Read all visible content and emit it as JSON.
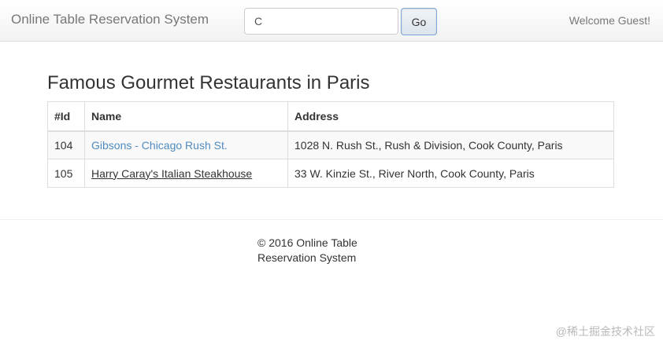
{
  "navbar": {
    "brand": "Online Table Reservation System",
    "search_value": "C",
    "go_label": "Go",
    "welcome": "Welcome Guest!"
  },
  "main": {
    "title": "Famous Gourmet Restaurants in Paris",
    "table": {
      "headers": [
        "#Id",
        "Name",
        "Address"
      ],
      "rows": [
        {
          "id": "104",
          "name": "Gibsons - Chicago Rush St.",
          "address": "1028 N. Rush St., Rush & Division, Cook County, Paris"
        },
        {
          "id": "105",
          "name": "Harry Caray's Italian Steakhouse",
          "address": "33 W. Kinzie St., River North, Cook County, Paris"
        }
      ]
    }
  },
  "footer": {
    "copyright": "© 2016 Online Table Reservation System"
  },
  "watermark": "@稀土掘金技术社区"
}
